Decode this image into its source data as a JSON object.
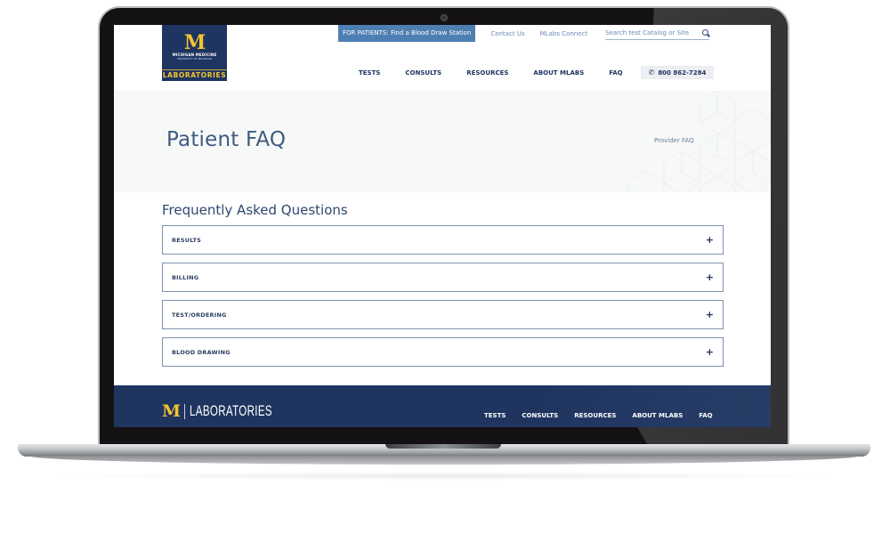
{
  "header": {
    "logo": {
      "mark": "M",
      "org_line": "MICHIGAN MEDICINE",
      "sub_line": "UNIVERSITY OF MICHIGAN",
      "unit": "LABORATORIES"
    },
    "utility": {
      "patients_button": "FOR PATIENTS: Find a Blood Draw Station",
      "links": [
        "Contact Us",
        "MLabs Connect"
      ],
      "search_placeholder": "Search test Catalog or Site",
      "search_value": ""
    },
    "nav": {
      "items": [
        "TESTS",
        "CONSULTS",
        "RESOURCES",
        "ABOUT MLABS",
        "FAQ"
      ],
      "phone": "800 862-7284"
    }
  },
  "hero": {
    "title": "Patient FAQ",
    "side_link": "Provider FAQ"
  },
  "faq": {
    "heading": "Frequently Asked Questions",
    "items": [
      {
        "label": "RESULTS",
        "expanded": false
      },
      {
        "label": "BILLING",
        "expanded": false
      },
      {
        "label": "TEST/ORDERING",
        "expanded": false
      },
      {
        "label": "BLOOD DRAWING",
        "expanded": false
      }
    ],
    "expand_symbol": "+"
  },
  "footer": {
    "logo_mark": "M",
    "logo_word": "LABORATORIES",
    "nav": [
      "TESTS",
      "CONSULTS",
      "RESOURCES",
      "ABOUT MLABS",
      "FAQ"
    ]
  },
  "colors": {
    "brand_navy": "#1e3461",
    "brand_maize": "#f4c430",
    "accent_blue": "#4e7fb3",
    "hero_bg": "#f7f8f8"
  }
}
